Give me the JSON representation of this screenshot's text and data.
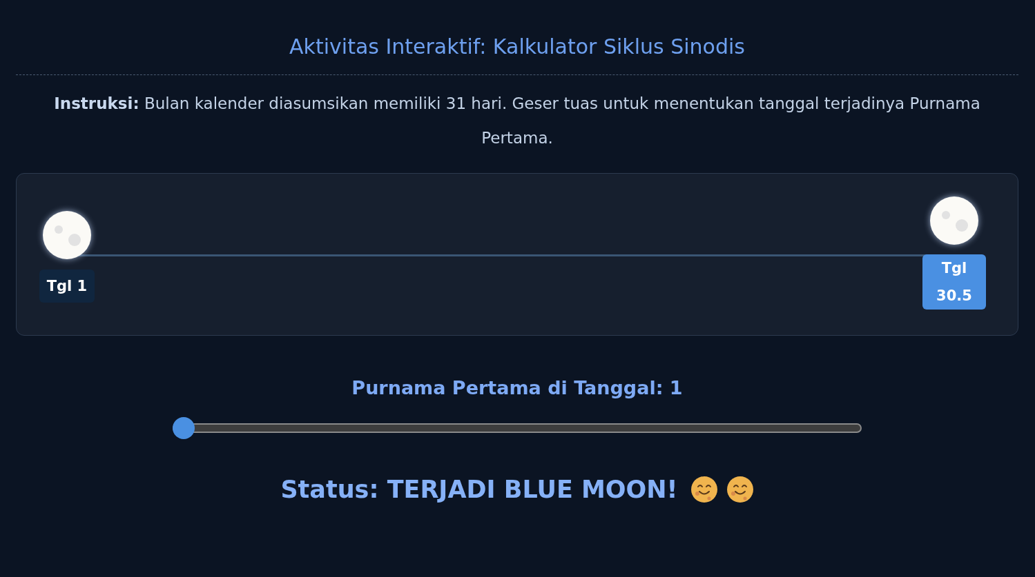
{
  "title": "Aktivitas Interaktif: Kalkulator Siklus Sinodis",
  "instruction": "**Instruksi:** Bulan kalender diasumsikan memiliki 31 hari. Geser tuas untuk menentukan tanggal terjadinya Purnama Pertama.",
  "timeline": {
    "moons": [
      {
        "line1": "Tgl 1",
        "highlighted": false
      },
      {
        "line1": "Tgl",
        "line2": "30.5",
        "highlighted": true
      }
    ]
  },
  "slider": {
    "label": "Purnama Pertama di Tanggal: 1",
    "level": 0
  },
  "status": {
    "text": "Status: TERJADI BLUE MOON!"
  }
}
